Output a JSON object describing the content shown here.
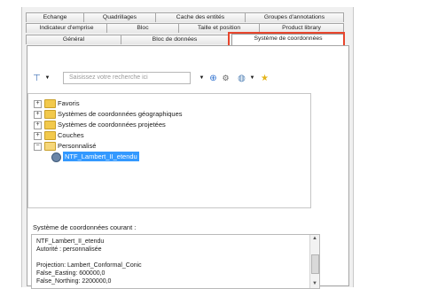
{
  "tabs": {
    "row1": [
      "Echange",
      "Quadrillages",
      "Cache des entités",
      "Groupes d'annotations"
    ],
    "row2": [
      "Indicateur d'emprise",
      "Bloc",
      "Taille et position",
      "Product library"
    ],
    "row3": [
      "Général",
      "Bloc de données",
      "Système de coordonnées"
    ]
  },
  "highlight_color": "#e8452c",
  "toolbar": {
    "search_placeholder": "Saisissez votre recherche ici",
    "icons": [
      "filter-icon",
      "dropdown-icon",
      "search-icon",
      "network-icon",
      "globe-icon",
      "favorite-star-icon"
    ]
  },
  "tree": {
    "items": [
      {
        "label": "Favoris",
        "expander": "+",
        "icon": "folder-icon"
      },
      {
        "label": "Systèmes de coordonnées géographiques",
        "expander": "+",
        "icon": "folder-icon"
      },
      {
        "label": "Systèmes de coordonnées projetées",
        "expander": "+",
        "icon": "folder-icon"
      },
      {
        "label": "Couches",
        "expander": "+",
        "icon": "folder-icon"
      },
      {
        "label": "Personnalisé",
        "expander": "−",
        "icon": "folder-open-icon"
      },
      {
        "label": "NTF_Lambert_II_etendu",
        "expander": "",
        "icon": "globe-icon",
        "selected": true
      }
    ]
  },
  "current": {
    "label": "Système de coordonnées courant :",
    "lines": [
      "NTF_Lambert_II_etendu",
      "Autorité : personnalisée",
      "",
      "Projection: Lambert_Conformal_Conic",
      "False_Easting: 600000,0",
      "False_Northing: 2200000,0"
    ]
  }
}
